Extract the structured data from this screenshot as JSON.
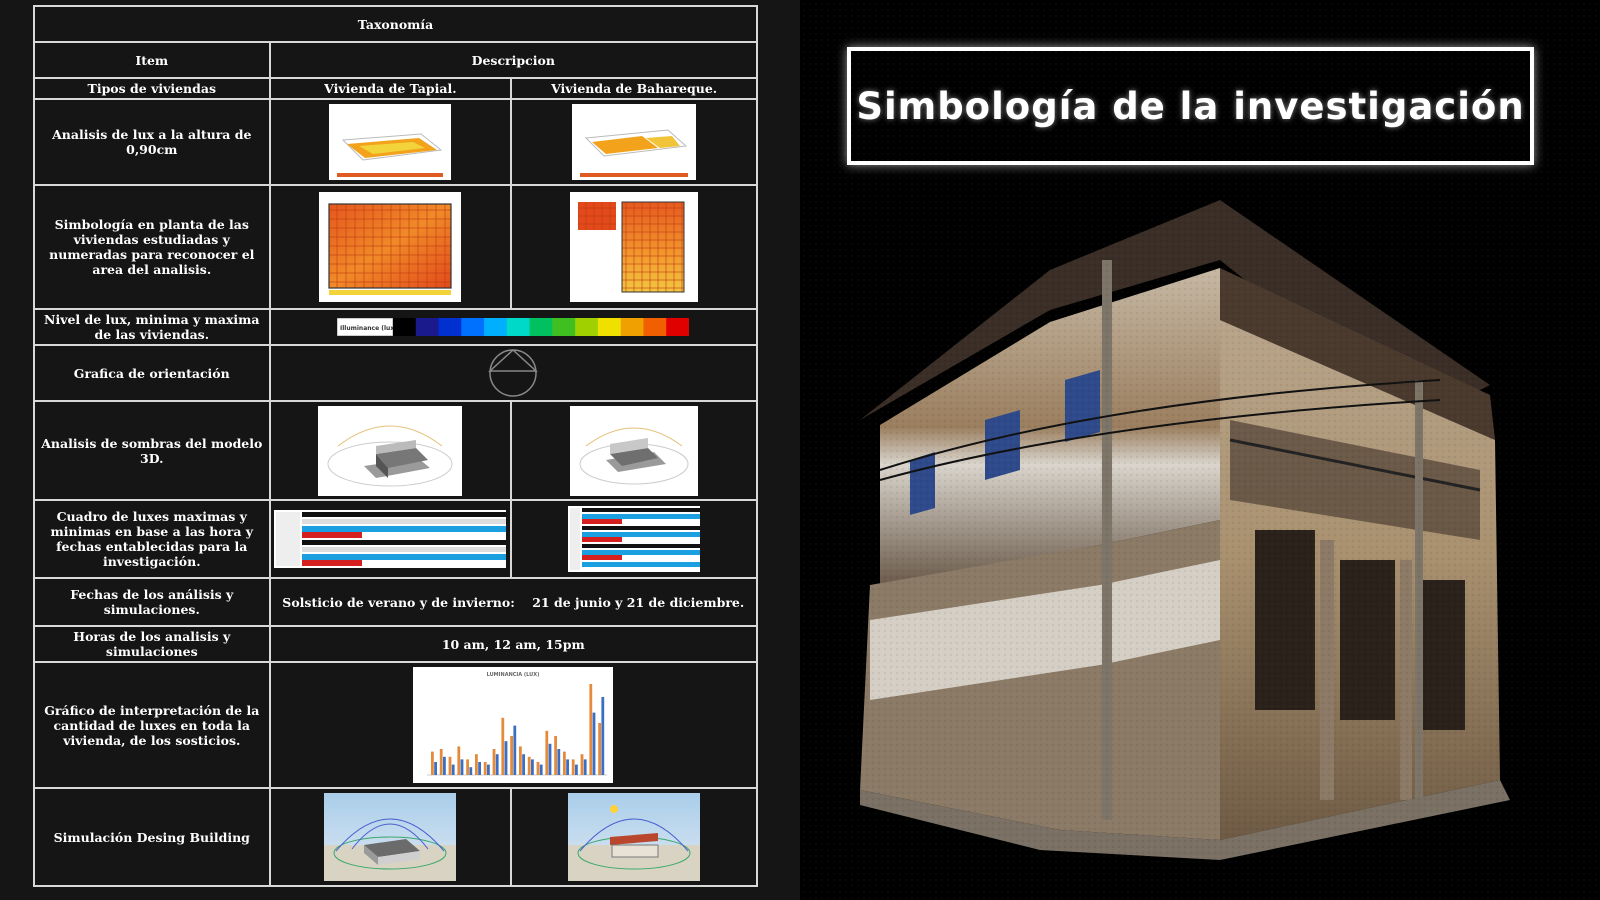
{
  "title": "Simbología de la investigación",
  "table": {
    "header": "Taxonomía",
    "col_item": "Item",
    "col_desc": "Descripcion",
    "rows": {
      "tipos": {
        "label": "Tipos de viviendas",
        "a": "Vivienda de Tapial.",
        "b": "Vivienda de Bahareque."
      },
      "lux": {
        "label": "Analisis de lux a la altura de 0,90cm"
      },
      "planta": {
        "label": "Simbología en planta de las viviendas estudiadas y numeradas para reconocer el area del analisis."
      },
      "nivel": {
        "label": "Nivel de lux, minima y maxima de las viviendas.",
        "legend_label": "Illuminance (lux)"
      },
      "orientacion": {
        "label": "Grafica de orientación"
      },
      "sombras": {
        "label": "Analisis de sombras del modelo 3D."
      },
      "cuadro": {
        "label": "Cuadro de luxes maximas y minimas en base a las hora y fechas entablecidas para la investigación."
      },
      "fechas": {
        "label": "Fechas de los análisis y simulaciones.",
        "value": "Solsticio de verano y de invierno:    21 de junio y 21 de diciembre."
      },
      "horas": {
        "label": "Horas de los analisis y simulaciones",
        "value": "10 am, 12 am, 15pm"
      },
      "grafico": {
        "label": "Gráfico de interpretación de la cantidad de luxes en toda la vivienda, de los sosticios.",
        "chart_title": "LUMINANCIA (LUX)"
      },
      "simulacion": {
        "label": "Simulación Desing Building"
      }
    }
  },
  "colors": {
    "accent_white": "#ffffff",
    "background": "#151515",
    "heat_low": "#ffe95a",
    "heat_high": "#d9341c"
  },
  "icons": {
    "orientation": "orientation-compass-icon"
  }
}
